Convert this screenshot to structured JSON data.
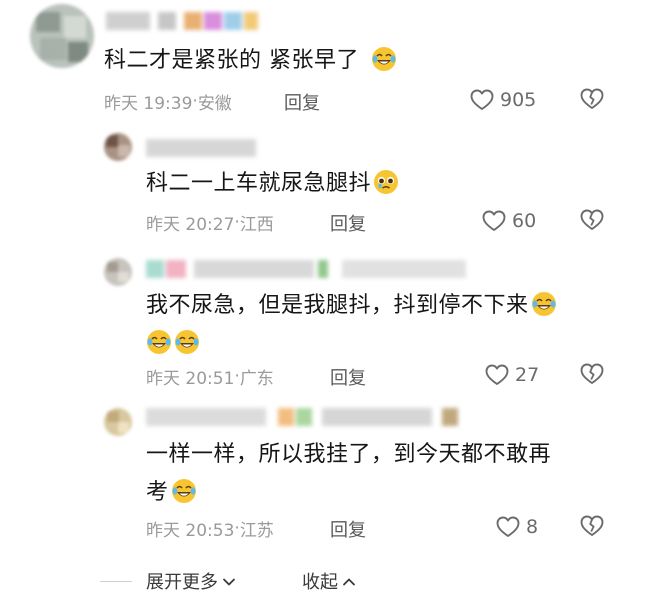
{
  "comments": [
    {
      "text": "科二才是紧张的 紧张早了",
      "emoji": "laughing-crying-emoji",
      "time": "昨天 19:39",
      "location": "安徽",
      "reply_label": "回复",
      "likes": "905"
    },
    {
      "text": "科二一上车就尿急腿抖",
      "emoji": "pleading-face-emoji",
      "time": "昨天 20:27",
      "location": "江西",
      "reply_label": "回复",
      "likes": "60"
    },
    {
      "line1": "我不尿急，但是我腿抖，抖到停不下来",
      "emoji": "laughing-crying-emoji",
      "time": "昨天 20:51",
      "location": "广东",
      "reply_label": "回复",
      "likes": "27"
    },
    {
      "line1": "一样一样，所以我挂了，到今天都不敢再",
      "line2": "考",
      "emoji": "laughing-crying-emoji",
      "time": "昨天 20:53",
      "location": "江苏",
      "reply_label": "回复",
      "likes": "8"
    }
  ],
  "footer": {
    "expand_more": "展开更多",
    "collapse": "收起"
  },
  "colors": {
    "text": "#161616",
    "meta": "#9a9a9a",
    "icon": "#6b6b6b",
    "emoji_yellow": "#f7c531"
  }
}
